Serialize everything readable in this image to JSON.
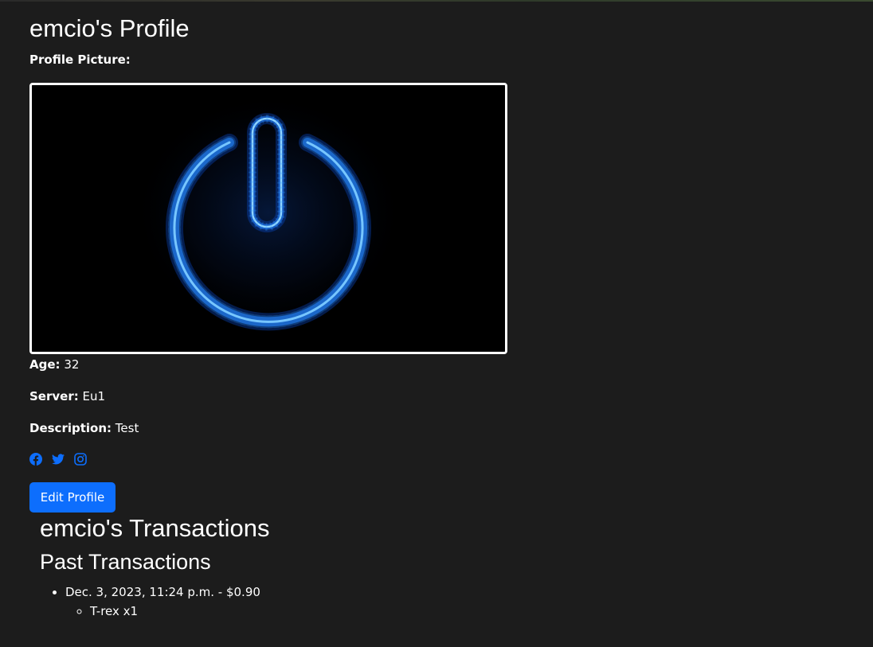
{
  "profile": {
    "title": "emcio's Profile",
    "picture_label": "Profile Picture:",
    "picture_icon": "glowing-power-icon",
    "age_label": "Age:",
    "age_value": "32",
    "server_label": "Server:",
    "server_value": "Eu1",
    "description_label": "Description:",
    "description_value": "Test",
    "socials": [
      "facebook-icon",
      "twitter-icon",
      "instagram-icon"
    ],
    "edit_button_label": "Edit Profile"
  },
  "transactions": {
    "title": "emcio's Transactions",
    "subtitle": "Past Transactions",
    "items": [
      {
        "summary": "Dec. 3, 2023, 11:24 p.m. - $0.90",
        "lines": [
          "T-rex x1"
        ]
      }
    ]
  },
  "colors": {
    "background": "#1c1c1c",
    "accent": "#0d6efd",
    "glow": "#3fa9ff"
  }
}
